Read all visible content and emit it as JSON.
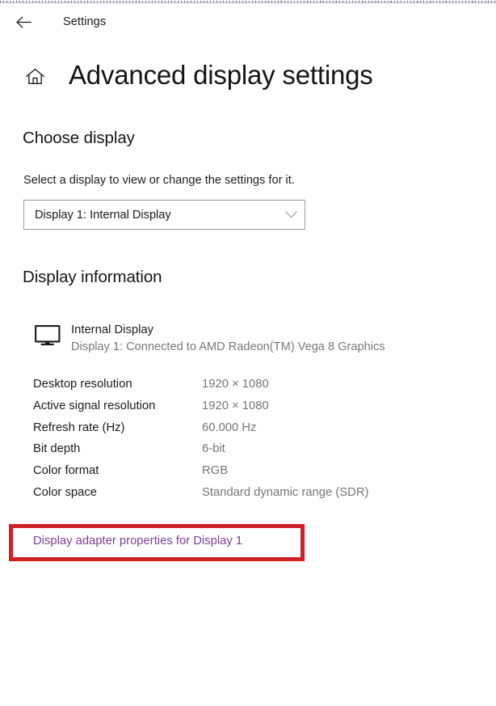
{
  "window": {
    "titlebar_label": "Settings",
    "back_icon": "back-arrow-icon"
  },
  "page": {
    "home_icon": "home-icon",
    "title": "Advanced display settings"
  },
  "choose_display": {
    "heading": "Choose display",
    "description": "Select a display to view or change the settings for it.",
    "dropdown": {
      "selected": "Display 1: Internal Display",
      "chevron_icon": "chevron-down-icon",
      "options": [
        "Display 1: Internal Display"
      ]
    }
  },
  "display_information": {
    "heading": "Display information",
    "monitor_icon": "monitor-icon",
    "display_name": "Internal Display",
    "connection": "Display 1: Connected to AMD Radeon(TM) Vega 8 Graphics",
    "rows": [
      {
        "label": "Desktop resolution",
        "value": "1920 × 1080"
      },
      {
        "label": "Active signal resolution",
        "value": "1920 × 1080"
      },
      {
        "label": "Refresh rate (Hz)",
        "value": "60.000 Hz"
      },
      {
        "label": "Bit depth",
        "value": "6-bit"
      },
      {
        "label": "Color format",
        "value": "RGB"
      },
      {
        "label": "Color space",
        "value": "Standard dynamic range (SDR)"
      }
    ],
    "adapter_link": "Display adapter properties for Display 1"
  },
  "annotation": {
    "highlight_color": "#cf2027"
  },
  "colors": {
    "link": "#7b3f98",
    "value_text": "#757575",
    "primary_text": "#1b1b1b",
    "background": "#ffffff",
    "combobox_border": "#9a9a9a"
  }
}
